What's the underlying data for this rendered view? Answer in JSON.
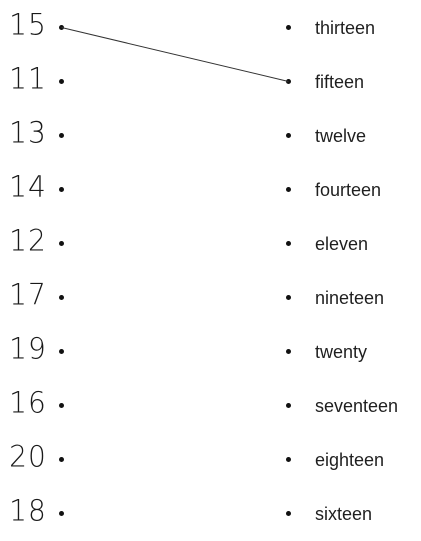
{
  "left_numbers": [
    "15",
    "11",
    "13",
    "14",
    "12",
    "17",
    "19",
    "16",
    "20",
    "18"
  ],
  "right_words": [
    "thirteen",
    "fifteen",
    "twelve",
    "fourteen",
    "eleven",
    "nineteen",
    "twenty",
    "seventeen",
    "eighteen",
    "sixteen"
  ],
  "connections": [
    {
      "from_number": "15",
      "to_word": "fifteen"
    }
  ],
  "colors": {
    "ink": "#222222",
    "line": "#333333"
  }
}
